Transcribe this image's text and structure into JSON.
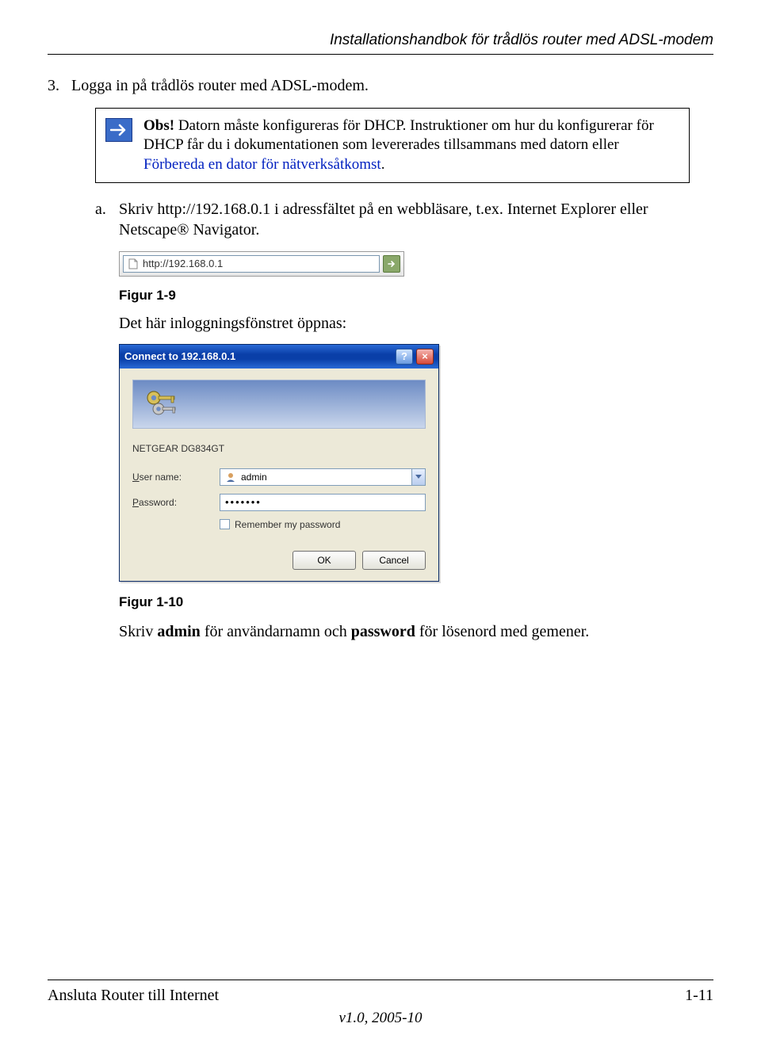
{
  "header": {
    "title": "Installationshandbok för trådlös router med ADSL-modem"
  },
  "step": {
    "number": "3.",
    "text": "Logga in på trådlös router med ADSL-modem."
  },
  "note": {
    "obs_label": "Obs!",
    "text1": " Datorn måste konfigureras för DHCP. Instruktioner om hur du konfigurerar för DHCP får du i dokumentationen som levererades tillsammans med datorn eller ",
    "link": "Förbereda en dator för nätverksåtkomst",
    "period": "."
  },
  "substep": {
    "letter": "a.",
    "text": "Skriv http://192.168.0.1 i adressfältet på en webbläsare, t.ex. Internet Explorer eller Netscape® Navigator."
  },
  "address_bar": {
    "url": "http://192.168.0.1"
  },
  "figure9": "Figur 1-9",
  "opens_text": "Det här inloggningsfönstret öppnas:",
  "dialog": {
    "title": "Connect to 192.168.0.1",
    "help": "?",
    "close": "×",
    "realm": "NETGEAR DG834GT",
    "user_label_pre": "",
    "user_label_u": "U",
    "user_label_post": "ser name:",
    "user_value": "admin",
    "pass_label_pre": "",
    "pass_label_u": "P",
    "pass_label_post": "assword:",
    "pass_value": "•••••••",
    "remember_u": "R",
    "remember_post": "emember my password",
    "ok": "OK",
    "cancel": "Cancel"
  },
  "figure10": "Figur 1-10",
  "final": {
    "pre": "Skriv ",
    "bold1": "admin",
    "mid": " för användarnamn och ",
    "bold2": "password",
    "post": " för lösenord med gemener."
  },
  "footer": {
    "left": "Ansluta Router till Internet",
    "right": "1-11",
    "version": "v1.0, 2005-10"
  }
}
